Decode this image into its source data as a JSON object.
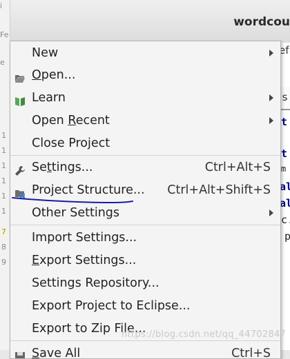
{
  "window": {
    "title": "wordcou"
  },
  "background": {
    "left_text": [
      "i",
      "Fe",
      "e"
    ],
    "line_numbers": [
      "1",
      "1",
      "1",
      "1",
      "1",
      "1",
      "7",
      "8",
      "9"
    ],
    "tab_text": "ef",
    "tab_file": "t.s",
    "code_fragments": [
      "t",
      "t",
      "m",
      "al",
      "al",
      "c.",
      "p"
    ]
  },
  "menu": {
    "items": [
      {
        "label": "New",
        "mnemonic_index": -1,
        "shortcut": "",
        "submenu": true,
        "icon": ""
      },
      {
        "label": "Open...",
        "mnemonic_index": 0,
        "shortcut": "",
        "submenu": false,
        "icon": "folder-open-icon"
      },
      {
        "label": "Learn",
        "mnemonic_index": -1,
        "shortcut": "",
        "submenu": true,
        "icon": "book-icon"
      },
      {
        "label": "Open Recent",
        "mnemonic_index": 5,
        "shortcut": "",
        "submenu": true,
        "icon": ""
      },
      {
        "label": "Close Project",
        "mnemonic_index": -1,
        "shortcut": "",
        "submenu": false,
        "icon": ""
      },
      {
        "label": "Settings...",
        "mnemonic_index": 2,
        "shortcut": "Ctrl+Alt+S",
        "submenu": false,
        "icon": "wrench-icon"
      },
      {
        "label": "Project Structure...",
        "mnemonic_index": -1,
        "shortcut": "Ctrl+Alt+Shift+S",
        "submenu": false,
        "icon": "project-structure-icon"
      },
      {
        "label": "Other Settings",
        "mnemonic_index": -1,
        "shortcut": "",
        "submenu": true,
        "icon": ""
      },
      {
        "label": "Import Settings...",
        "mnemonic_index": -1,
        "shortcut": "",
        "submenu": false,
        "icon": ""
      },
      {
        "label": "Export Settings...",
        "mnemonic_index": 0,
        "shortcut": "",
        "submenu": false,
        "icon": ""
      },
      {
        "label": "Settings Repository...",
        "mnemonic_index": -1,
        "shortcut": "",
        "submenu": false,
        "icon": ""
      },
      {
        "label": "Export Project to Eclipse...",
        "mnemonic_index": -1,
        "shortcut": "",
        "submenu": false,
        "icon": ""
      },
      {
        "label": "Export to Zip File...",
        "mnemonic_index": -1,
        "shortcut": "",
        "submenu": false,
        "icon": ""
      },
      {
        "label": "Save All",
        "mnemonic_index": 0,
        "shortcut": "Ctrl+S",
        "submenu": false,
        "icon": "save-icon"
      }
    ]
  },
  "annotation": {
    "color": "#1a1aa8"
  },
  "watermark": "https://blog.csdn.net/qq_44702847"
}
